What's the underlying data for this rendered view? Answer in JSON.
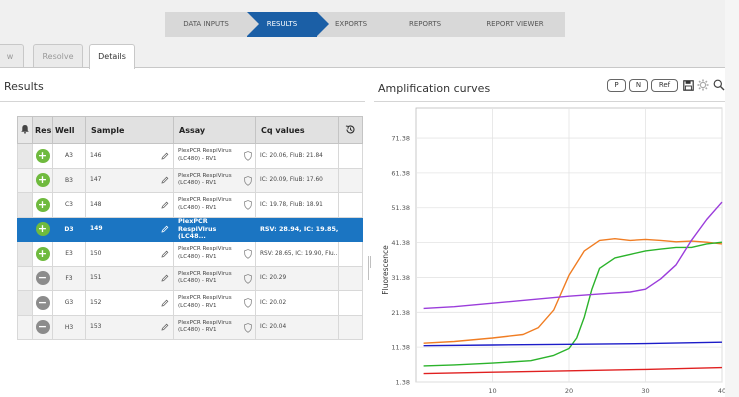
{
  "wizard": [
    "DATA INPUTS",
    "RESULTS",
    "EXPORTS",
    "REPORTS",
    "REPORT VIEWER"
  ],
  "tabs": {
    "partial": "w",
    "resolve": "Resolve",
    "details": "Details"
  },
  "results": {
    "title": "Results",
    "columns": {
      "res": "Res",
      "well": "Well",
      "sample": "Sample",
      "assay": "Assay",
      "cq": "Cq values"
    },
    "rows": [
      {
        "status": "positive",
        "well": "A3",
        "sample": "146",
        "assay_l1": "PlexPCR RespiVirus",
        "assay_l2": "(LC480) - RV1",
        "cq": "IC: 20.06, FluB: 21.84"
      },
      {
        "status": "positive",
        "well": "B3",
        "sample": "147",
        "assay_l1": "PlexPCR RespiVirus",
        "assay_l2": "(LC480) - RV1",
        "cq": "IC: 20.09, FluB: 17.60"
      },
      {
        "status": "positive",
        "well": "C3",
        "sample": "148",
        "assay_l1": "PlexPCR RespiVirus",
        "assay_l2": "(LC480) - RV1",
        "cq": "IC: 19.78, FluB: 18.91"
      },
      {
        "status": "positive",
        "well": "D3",
        "sample": "149",
        "assay_l1": "PlexPCR",
        "assay_l2": "RespiVirus (LC48...",
        "cq": "RSV: 28.94, IC: 19.85, F..."
      },
      {
        "status": "positive",
        "well": "E3",
        "sample": "150",
        "assay_l1": "PlexPCR RespiVirus",
        "assay_l2": "(LC480) - RV1",
        "cq": "RSV: 28.65, IC: 19.90, Flu..."
      },
      {
        "status": "negative",
        "well": "F3",
        "sample": "151",
        "assay_l1": "PlexPCR RespiVirus",
        "assay_l2": "(LC480) - RV1",
        "cq": "IC: 20.29"
      },
      {
        "status": "negative",
        "well": "G3",
        "sample": "152",
        "assay_l1": "PlexPCR RespiVirus",
        "assay_l2": "(LC480) - RV1",
        "cq": "IC: 20.02"
      },
      {
        "status": "negative",
        "well": "H3",
        "sample": "153",
        "assay_l1": "PlexPCR RespiVirus",
        "assay_l2": "(LC480) - RV1",
        "cq": "IC: 20.04"
      }
    ],
    "selected_row": 3
  },
  "amplification": {
    "title": "Amplification curves",
    "buttons": {
      "p": "P",
      "n": "N",
      "ref": "Ref"
    }
  },
  "chart_data": {
    "type": "line",
    "ylabel": "Fluorescence",
    "xlim": [
      0,
      40
    ],
    "ylim": [
      1.38,
      80
    ],
    "x_ticks": [
      "10",
      "20",
      "30",
      "40"
    ],
    "y_ticks": [
      "1.38",
      "11.38",
      "21.38",
      "31.38",
      "41.38",
      "51.38",
      "61.38",
      "71.38"
    ],
    "series": [
      {
        "color": "#f07d23",
        "x": [
          1,
          5,
          10,
          14,
          16,
          18,
          20,
          22,
          24,
          26,
          28,
          30,
          32,
          34,
          36,
          38,
          40
        ],
        "y": [
          12.5,
          13,
          14,
          15,
          17,
          22,
          32,
          39,
          42,
          42.5,
          42,
          42.3,
          42,
          41.6,
          41.8,
          41.5,
          41
        ]
      },
      {
        "color": "#2bb32b",
        "x": [
          1,
          5,
          10,
          15,
          18,
          20,
          21,
          22,
          23,
          24,
          26,
          28,
          30,
          32,
          34,
          36,
          38,
          40
        ],
        "y": [
          6,
          6.3,
          6.8,
          7.5,
          9,
          11,
          14,
          20,
          28,
          34,
          37,
          38,
          39,
          39.5,
          40,
          40,
          41,
          41.5
        ]
      },
      {
        "color": "#9b3ddb",
        "x": [
          1,
          5,
          10,
          15,
          20,
          25,
          28,
          30,
          32,
          34,
          36,
          38,
          40
        ],
        "y": [
          22.5,
          23,
          24,
          25,
          26,
          26.8,
          27.2,
          28,
          31,
          35,
          42,
          48,
          53
        ]
      },
      {
        "color": "#1c1cc8",
        "x": [
          1,
          10,
          20,
          30,
          40
        ],
        "y": [
          11.8,
          12,
          12.2,
          12.4,
          12.8
        ]
      },
      {
        "color": "#e02020",
        "x": [
          1,
          10,
          20,
          30,
          40
        ],
        "y": [
          3.8,
          4.2,
          4.6,
          5,
          5.5
        ]
      }
    ]
  }
}
